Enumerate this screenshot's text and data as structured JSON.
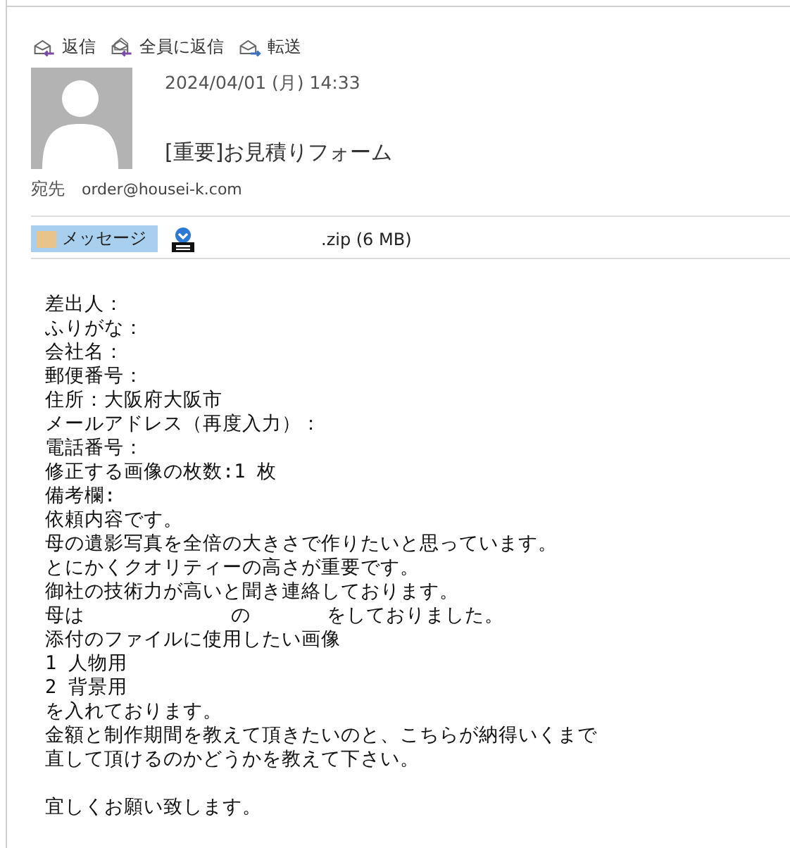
{
  "actions": [
    {
      "kind": "reply",
      "label": "返信"
    },
    {
      "kind": "reply_all",
      "label": "全員に返信"
    },
    {
      "kind": "forward",
      "label": "転送"
    }
  ],
  "message": {
    "date": "2024/04/01 (月) 14:33",
    "subject": "[重要]お見積りフォーム",
    "to_label": "宛先",
    "to": "order@housei-k.com"
  },
  "attachments": [
    {
      "kind": "message",
      "label": "メッセージ",
      "selected": true
    },
    {
      "kind": "zip",
      "label": ".zip (6 MB)",
      "selected": false
    }
  ],
  "body": [
    {
      "kind": "text",
      "text": "差出人："
    },
    {
      "kind": "text",
      "text": "ふりがな："
    },
    {
      "kind": "text",
      "text": "会社名："
    },
    {
      "kind": "text",
      "text": "郵便番号："
    },
    {
      "kind": "text",
      "text": "住所：大阪府大阪市"
    },
    {
      "kind": "text",
      "text": "メールアドレス（再度入力）："
    },
    {
      "kind": "text",
      "text": "電話番号："
    },
    {
      "kind": "text",
      "text": "修正する画像の枚数:1 枚"
    },
    {
      "kind": "text",
      "text": "備考欄:"
    },
    {
      "kind": "text",
      "text": "依頼内容です。"
    },
    {
      "kind": "text",
      "text": "母の遺影写真を全倍の大きさで作りたいと思っています。"
    },
    {
      "kind": "text",
      "text": "とにかくクオリティーの高さが重要です。"
    },
    {
      "kind": "text",
      "text": "御社の技術力が高いと聞き連絡しております。"
    },
    {
      "kind": "segments",
      "parts": [
        "母は",
        "の",
        "をしておりました。"
      ]
    },
    {
      "kind": "text",
      "text": "添付のファイルに使用したい画像"
    },
    {
      "kind": "text",
      "text": "1 人物用"
    },
    {
      "kind": "text",
      "text": "2 背景用"
    },
    {
      "kind": "text",
      "text": "を入れております。"
    },
    {
      "kind": "text",
      "text": "金額と制作期間を教えて頂きたいのと、こちらが納得いくまで"
    },
    {
      "kind": "text",
      "text": "直して頂けるのかどうかを教えて下さい。"
    },
    {
      "kind": "blank"
    },
    {
      "kind": "text",
      "text": "宜しくお願い致します。"
    }
  ]
}
